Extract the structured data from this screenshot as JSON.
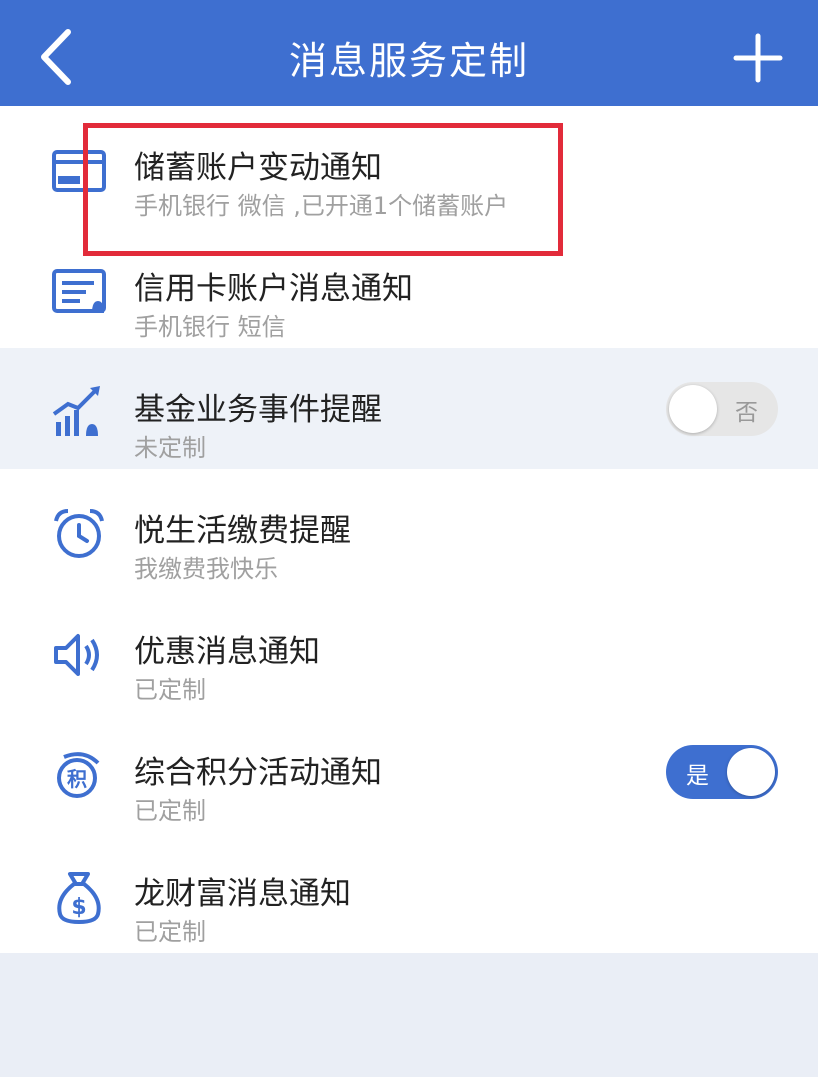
{
  "header": {
    "title": "消息服务定制",
    "back_icon": "chevron-left-icon",
    "add_icon": "plus-icon"
  },
  "items": [
    {
      "title": "储蓄账户变动通知",
      "subtitle": "手机银行 微信 ,已开通1个储蓄账户",
      "icon": "debit-card-icon"
    },
    {
      "title": "信用卡账户消息通知",
      "subtitle": "手机银行 短信",
      "icon": "credit-card-bell-icon"
    },
    {
      "title": "基金业务事件提醒",
      "subtitle": "未定制",
      "icon": "fund-chart-bell-icon",
      "toggle": {
        "state": "off",
        "label": "否"
      }
    },
    {
      "title": "悦生活缴费提醒",
      "subtitle": "我缴费我快乐",
      "icon": "alarm-clock-icon"
    },
    {
      "title": "优惠消息通知",
      "subtitle": "已定制",
      "icon": "speaker-icon"
    },
    {
      "title": "综合积分活动通知",
      "subtitle": "已定制",
      "icon": "points-badge-icon",
      "icon_text": "积",
      "toggle": {
        "state": "on",
        "label": "是"
      }
    },
    {
      "title": "龙财富消息通知",
      "subtitle": "已定制",
      "icon": "money-bag-icon",
      "icon_text": "$"
    }
  ],
  "colors": {
    "header_bg": "#3e6fd0",
    "icon_blue": "#3e6fd0",
    "highlight_box": "#e22b3a",
    "highlight_row_bg": "#eef2f8",
    "page_bg": "#eaeef6"
  }
}
